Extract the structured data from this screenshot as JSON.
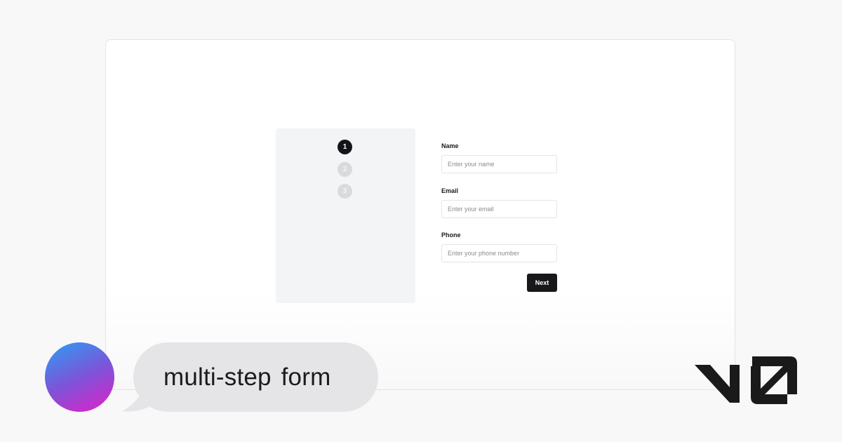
{
  "stepper": {
    "steps": [
      {
        "label": "1",
        "state": "active"
      },
      {
        "label": "2",
        "state": "inactive"
      },
      {
        "label": "3",
        "state": "inactive"
      }
    ]
  },
  "form": {
    "fields": [
      {
        "label": "Name",
        "placeholder": "Enter your name"
      },
      {
        "label": "Email",
        "placeholder": "Enter your email"
      },
      {
        "label": "Phone",
        "placeholder": "Enter your phone number"
      }
    ],
    "next_label": "Next"
  },
  "prompt": {
    "text": "multi-step form"
  },
  "colors": {
    "page_background": "#f8f8f8",
    "stepper_background": "#f3f4f6",
    "active_step": "#111418",
    "inactive_step": "#d9dadc",
    "button": "#18181b",
    "bubble": "#e5e5e7",
    "logo": "#1a1a1a"
  },
  "icons": {
    "logo": "v0-logo-icon",
    "avatar": "gradient-avatar"
  }
}
